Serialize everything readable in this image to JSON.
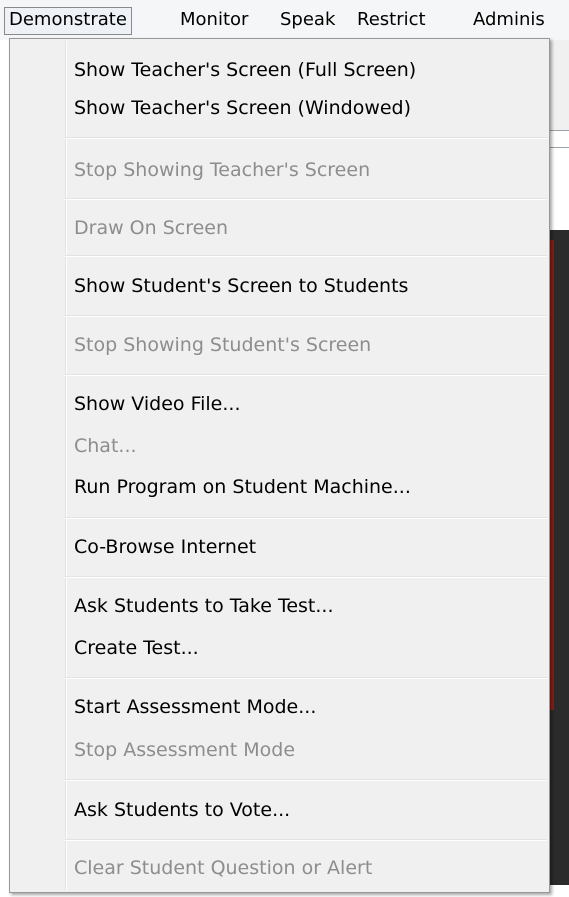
{
  "menubar": {
    "items": [
      "Demonstrate",
      "Monitor",
      "Speak",
      "Restrict",
      "Adminis"
    ]
  },
  "menu": {
    "items": [
      {
        "label": "Show Teacher's Screen (Full Screen)",
        "enabled": true
      },
      {
        "label": "Show Teacher's Screen (Windowed)",
        "enabled": true
      },
      {
        "label": "Stop Showing Teacher's Screen",
        "enabled": false
      },
      {
        "label": "Draw On Screen",
        "enabled": false
      },
      {
        "label": "Show Student's Screen to Students",
        "enabled": true
      },
      {
        "label": "Stop Showing Student's Screen",
        "enabled": false
      },
      {
        "label": "Show Video File...",
        "enabled": true
      },
      {
        "label": "Chat...",
        "enabled": false
      },
      {
        "label": "Run Program on Student Machine...",
        "enabled": true
      },
      {
        "label": "Co-Browse Internet",
        "enabled": true
      },
      {
        "label": "Ask Students to Take Test...",
        "enabled": true
      },
      {
        "label": "Create Test...",
        "enabled": true
      },
      {
        "label": "Start Assessment Mode...",
        "enabled": true
      },
      {
        "label": "Stop Assessment Mode",
        "enabled": false
      },
      {
        "label": "Ask Students to Vote...",
        "enabled": true
      },
      {
        "label": "Clear Student Question or Alert",
        "enabled": false
      }
    ]
  }
}
